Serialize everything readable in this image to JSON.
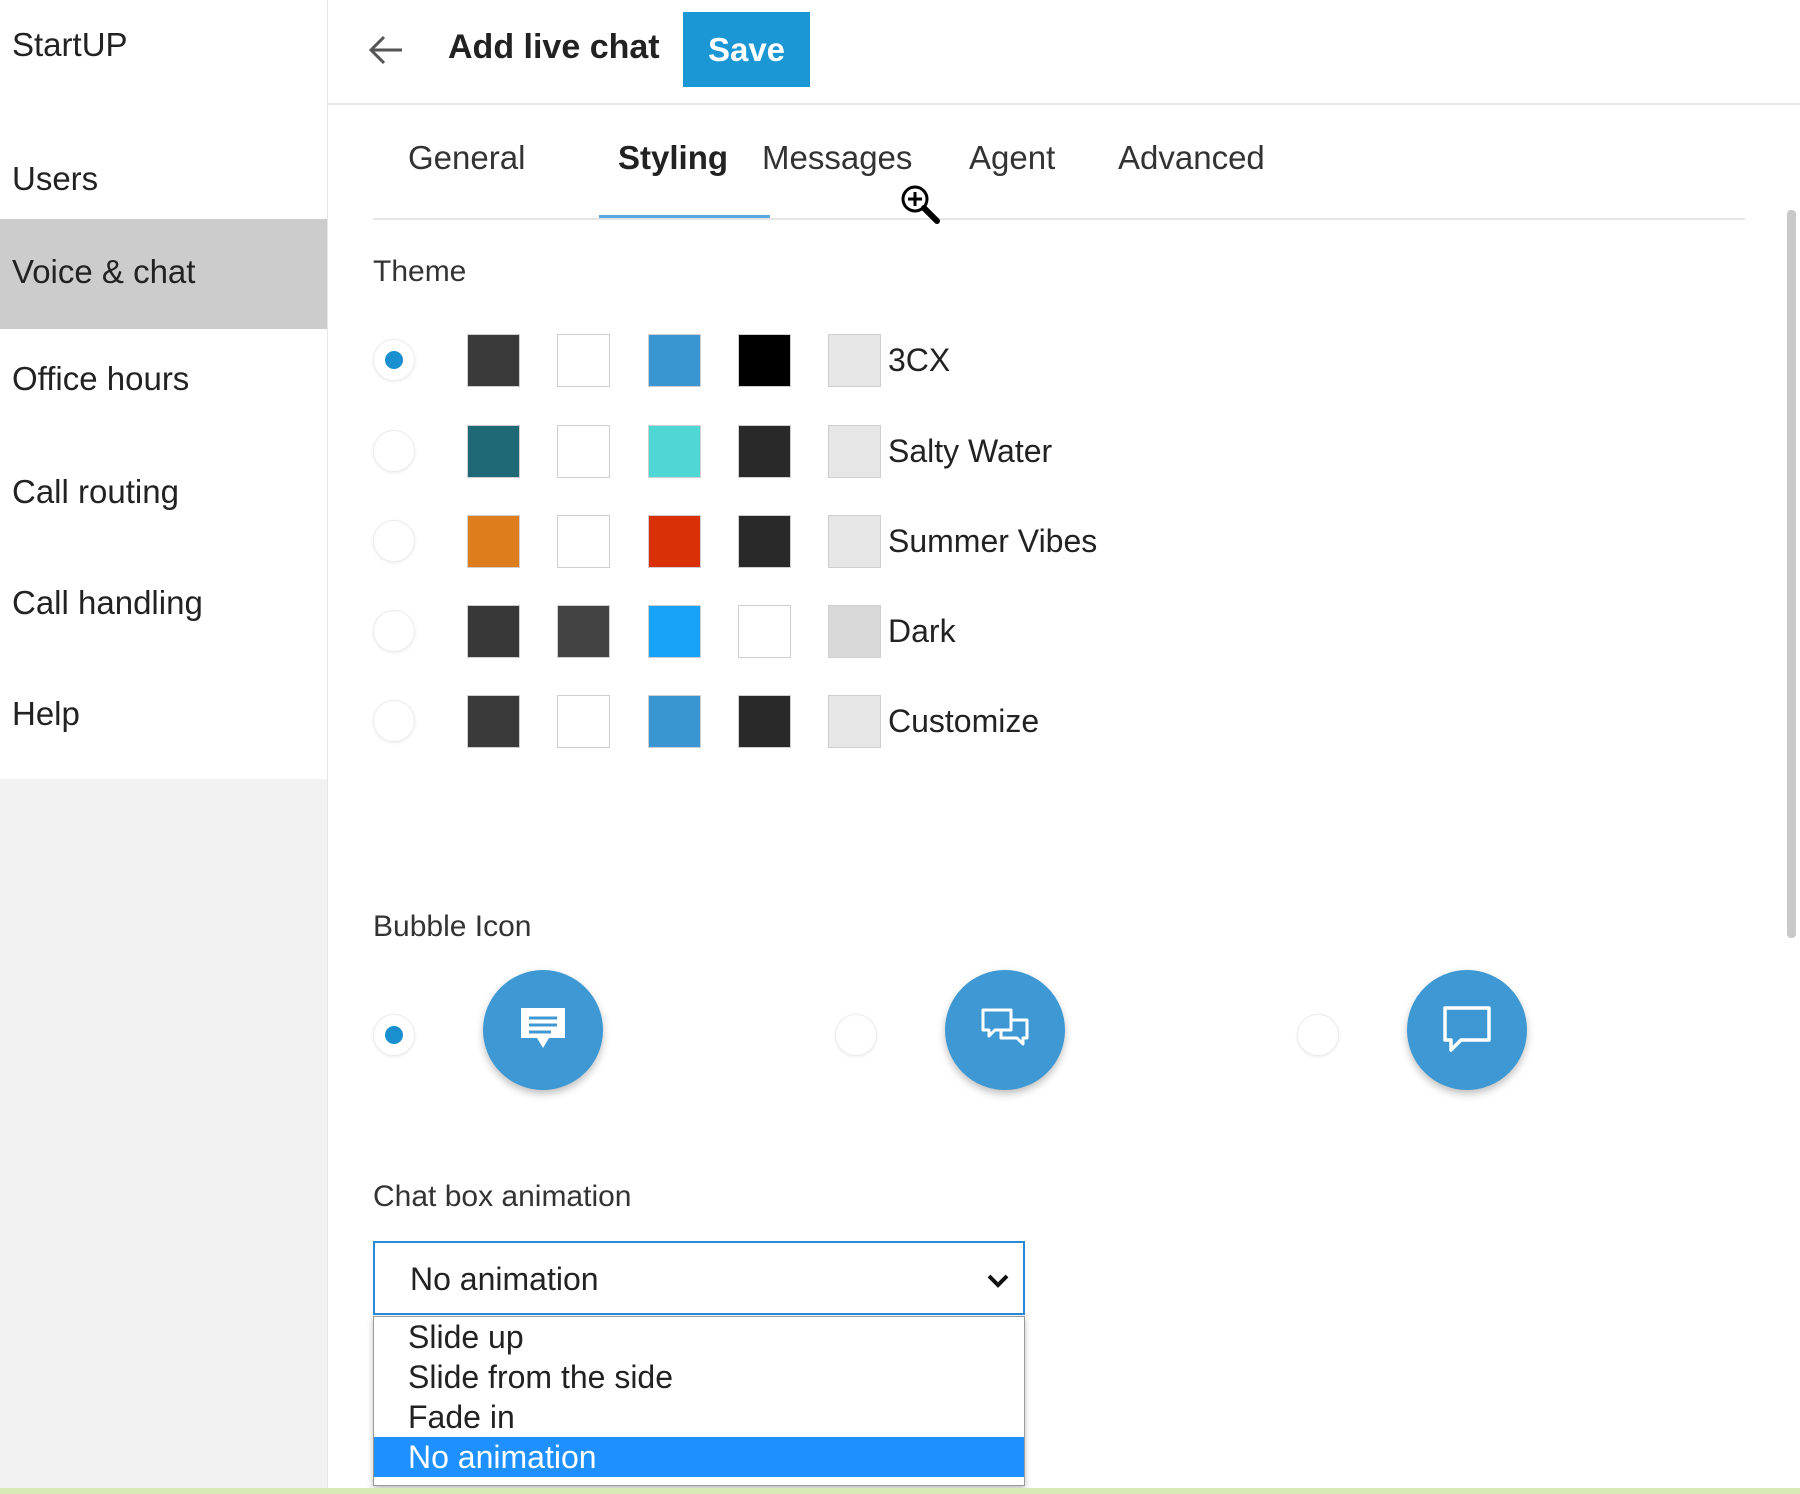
{
  "sidebar": {
    "items": [
      {
        "label": "StartUP",
        "active": false
      },
      {
        "label": "Users",
        "active": false
      },
      {
        "label": "Voice & chat",
        "active": true
      },
      {
        "label": "Office hours",
        "active": false
      },
      {
        "label": "Call routing",
        "active": false
      },
      {
        "label": "Call handling",
        "active": false
      },
      {
        "label": "Help",
        "active": false
      }
    ]
  },
  "header": {
    "back_icon": "arrow-left-icon",
    "title": "Add live chat",
    "save_label": "Save"
  },
  "tabs": [
    {
      "label": "General",
      "active": false
    },
    {
      "label": "Styling",
      "active": true
    },
    {
      "label": "Messages",
      "active": false
    },
    {
      "label": "Agent",
      "active": false
    },
    {
      "label": "Advanced",
      "active": false
    }
  ],
  "theme": {
    "label": "Theme",
    "options": [
      {
        "name": "3CX",
        "selected": true,
        "colors": [
          "#3a3a3a",
          "#ffffff",
          "#3996d3",
          "#000000",
          "#e6e6e6"
        ]
      },
      {
        "name": "Salty Water",
        "selected": false,
        "colors": [
          "#1f6875",
          "#ffffff",
          "#4fd7d6",
          "#292929",
          "#e6e6e6"
        ]
      },
      {
        "name": "Summer Vibes",
        "selected": false,
        "colors": [
          "#dd7d1b",
          "#ffffff",
          "#d93008",
          "#292929",
          "#e6e6e6"
        ]
      },
      {
        "name": "Dark",
        "selected": false,
        "colors": [
          "#383838",
          "#434343",
          "#18a2f7",
          "#ffffff",
          "#d9d9d9"
        ]
      },
      {
        "name": "Customize",
        "selected": false,
        "colors": [
          "#3a3a3a",
          "#ffffff",
          "#3996d3",
          "#292929",
          "#e6e6e6"
        ]
      }
    ]
  },
  "bubble_icon": {
    "label": "Bubble Icon",
    "options": [
      {
        "icon": "chat-bubble-lines-icon",
        "selected": true
      },
      {
        "icon": "chat-bubbles-double-icon",
        "selected": false
      },
      {
        "icon": "chat-bubble-empty-icon",
        "selected": false
      }
    ],
    "color": "#3d98d3"
  },
  "chat_box_animation": {
    "label": "Chat box animation",
    "value": "No animation",
    "options": [
      "Slide up",
      "Slide from the side",
      "Fade in",
      "No animation"
    ],
    "selected_index": 3
  },
  "colors": {
    "accent": "#1a97d4",
    "sidebar_active": "#cccccc"
  }
}
